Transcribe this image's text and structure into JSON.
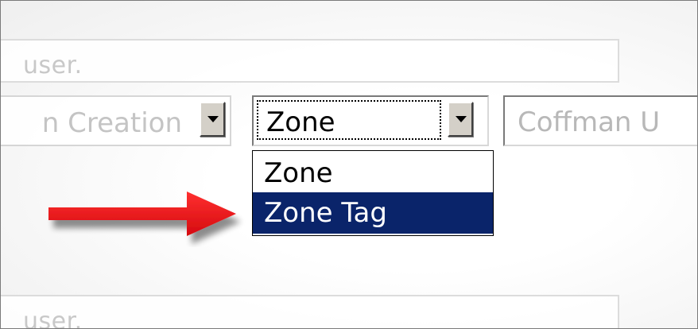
{
  "fields": {
    "top_input_placeholder": "user.",
    "bottom_input_placeholder": "user."
  },
  "selects": {
    "left_value": "n Creation",
    "zone_value": "Zone",
    "right_value": "Coffman U"
  },
  "dropdown": {
    "options": [
      {
        "label": "Zone",
        "selected": false
      },
      {
        "label": "Zone Tag",
        "selected": true
      }
    ]
  },
  "colors": {
    "highlight": "#0a246a",
    "arrow": "#e0161a",
    "button_face": "#d4d0c8"
  },
  "icons": {
    "dropdown_arrow": "chevron-down-icon",
    "pointer": "arrow-right-icon"
  }
}
